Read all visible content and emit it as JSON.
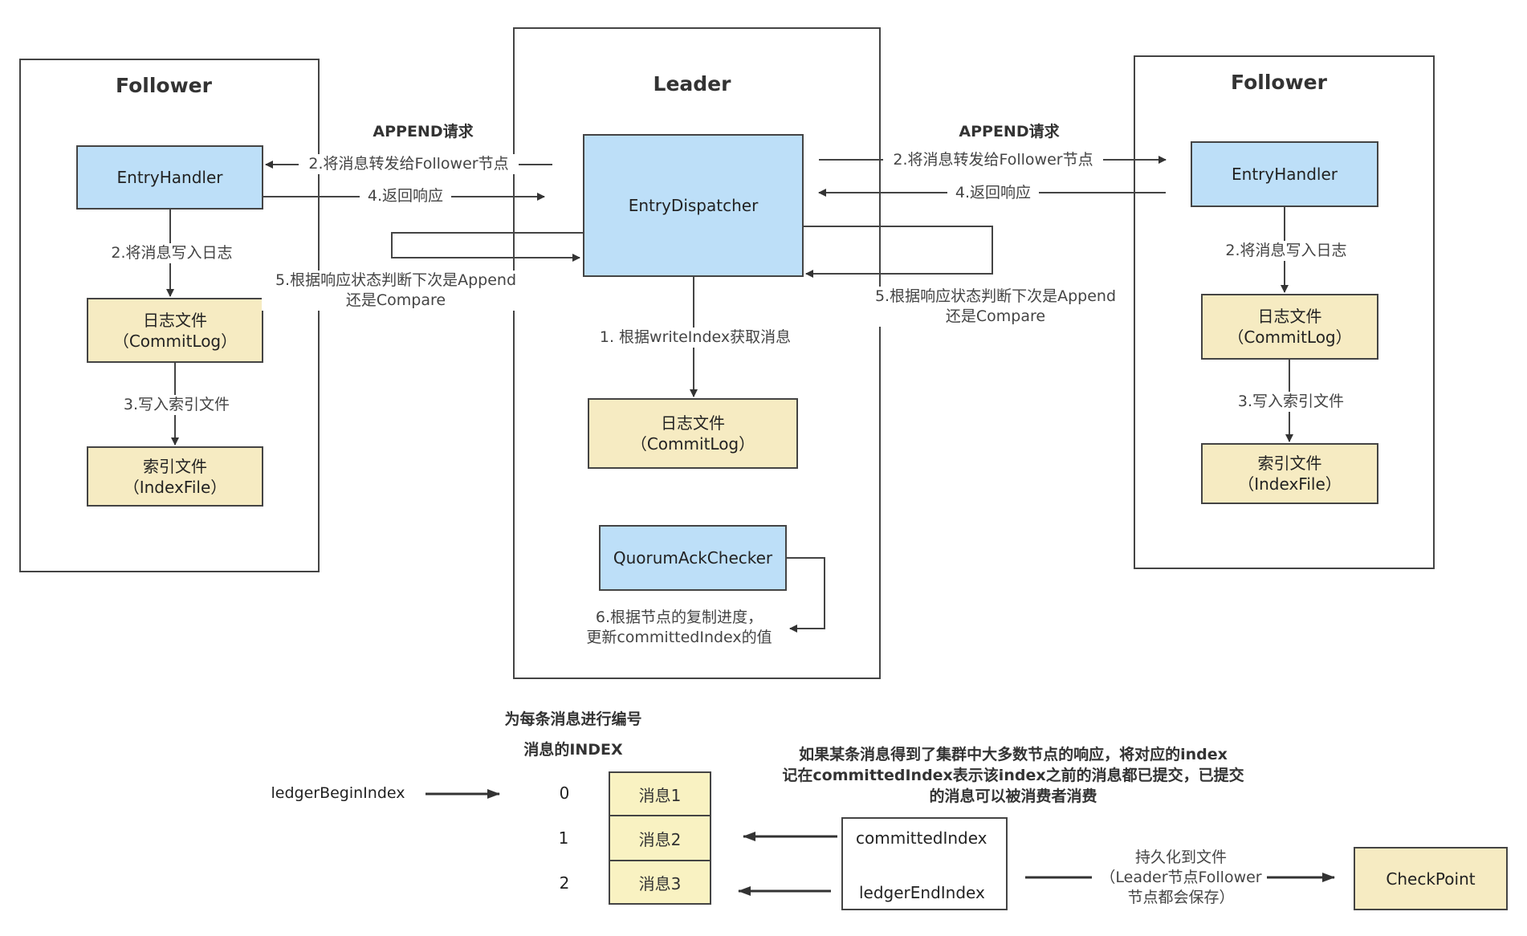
{
  "leader": {
    "title": "Leader",
    "entry_dispatcher": "EntryDispatcher",
    "commitlog": {
      "line1": "日志文件",
      "line2": "（CommitLog）"
    },
    "quorum_checker": "QuorumAckChecker",
    "step1": "1. 根据writeIndex获取消息",
    "step6": {
      "line1": "6.根据节点的复制进度，",
      "line2": "更新committedIndex的值"
    }
  },
  "follower_left": {
    "title": "Follower",
    "entry_handler": "EntryHandler",
    "commitlog": {
      "line1": "日志文件",
      "line2": "（CommitLog）"
    },
    "indexfile": {
      "line1": "索引文件",
      "line2": "（IndexFile）"
    },
    "step2": "2.将消息写入日志",
    "step3": "3.写入索引文件"
  },
  "follower_right": {
    "title": "Follower",
    "entry_handler": "EntryHandler",
    "commitlog": {
      "line1": "日志文件",
      "line2": "（CommitLog）"
    },
    "indexfile": {
      "line1": "索引文件",
      "line2": "（IndexFile）"
    },
    "step2": "2.将消息写入日志",
    "step3": "3.写入索引文件"
  },
  "links_left": {
    "heading": "APPEND请求",
    "forward": "2.将消息转发给Follower节点",
    "response": "4.返回响应",
    "decide": {
      "line1": "5.根据响应状态判断下次是Append",
      "line2": "还是Compare"
    }
  },
  "links_right": {
    "heading": "APPEND请求",
    "forward": "2.将消息转发给Follower节点",
    "response": "4.返回响应",
    "decide": {
      "line1": "5.根据响应状态判断下次是Append",
      "line2": "还是Compare"
    }
  },
  "ledger": {
    "numbering_caption": "为每条消息进行编号",
    "index_caption": "消息的INDEX",
    "begin_index_label": "ledgerBeginIndex",
    "indices": [
      "0",
      "1",
      "2"
    ],
    "messages": [
      "消息1",
      "消息2",
      "消息3"
    ],
    "commit_note": {
      "line1": "如果某条消息得到了集群中大多数节点的响应，将对应的index",
      "line2": "记在committedIndex表示该index之前的消息都已提交，已提交",
      "line3": "的消息可以被消费者消费"
    },
    "committed_index_label": "committedIndex",
    "end_index_label": "ledgerEndIndex",
    "persist_note": {
      "line1": "持久化到文件",
      "line2": "（Leader节点Follower",
      "line3": "节点都会保存）"
    },
    "checkpoint": "CheckPoint"
  }
}
